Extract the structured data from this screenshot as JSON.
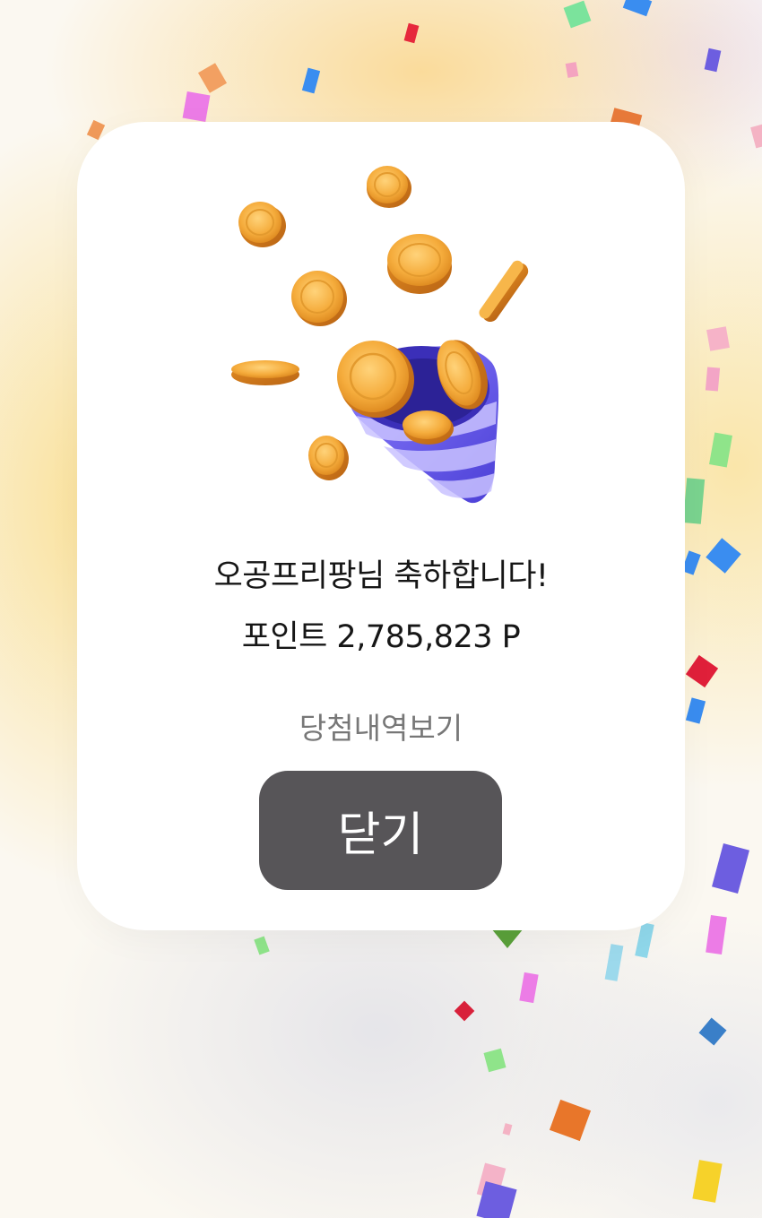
{
  "dialog": {
    "greeting": "오공프리팡님 축하합니다!",
    "points": "포인트 2,785,823 P",
    "history_link": "당첨내역보기",
    "close_label": "닫기"
  },
  "illustration": {
    "icon": "party-popper-with-coins-icon"
  },
  "colors": {
    "card_background": "#ffffff",
    "close_button": "#575558",
    "text_primary": "#161616",
    "text_link": "#777777",
    "coin": "#f3a93c",
    "popper": "#6a5fe6"
  }
}
